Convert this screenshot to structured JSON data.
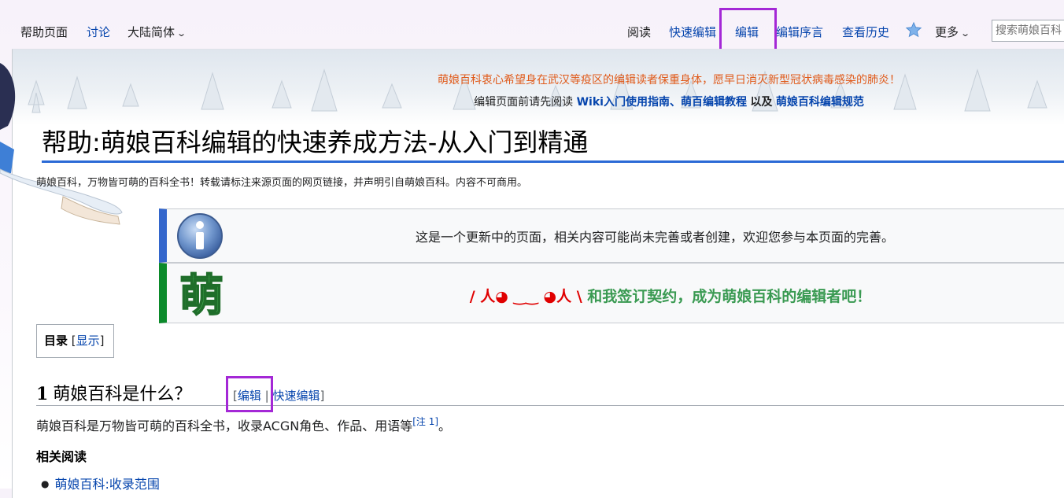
{
  "top_nav": {
    "left": {
      "help_page": "帮助页面",
      "discussion": "讨论",
      "variant": "大陆简体"
    },
    "right": {
      "read": "阅读",
      "quick_edit": "快速编辑",
      "edit": "编辑",
      "edit_intro": "编辑序言",
      "view_history": "查看历史",
      "more": "更多",
      "search_placeholder": "搜索萌娘百科"
    }
  },
  "site_notice": {
    "line1": "萌娘百科衷心希望身在武汉等疫区的编辑读者保重身体，愿早日消灭新型冠状病毒感染的肺炎！",
    "line2_prefix": "编辑页面前请先阅读",
    "link1": "Wiki入门使用指南",
    "sep": "、",
    "link2": "萌百编辑教程",
    "and": "以及",
    "link3": "萌娘百科编辑规范"
  },
  "page": {
    "title": "帮助:萌娘百科编辑的快速养成方法-从入门到精通",
    "tagline": "萌娘百科，万物皆可萌的百科全书！转载请标注来源页面的网页链接，并声明引自萌娘百科。内容不可商用。"
  },
  "notices": {
    "updating": "这是一个更新中的页面，相关内容可能尚未完善或者创建，欢迎您参与本页面的完善。",
    "moe_icon_char": "萌",
    "contract_kaomoji": "/ 人◕ ‿‿ ◕人 \\",
    "contract_text": "和我签订契约，成为萌娘百科的编辑者吧！"
  },
  "toc": {
    "label": "目录",
    "bracket_open": "[",
    "toggle": "显示",
    "bracket_close": "]"
  },
  "section1": {
    "number": "1",
    "heading": "萌娘百科是什么？",
    "bracket_open": "[",
    "edit": "编辑",
    "sep": " | ",
    "quick_edit": "快速编辑",
    "bracket_close": "]"
  },
  "body": {
    "para1_text": "萌娘百科是万物皆可萌的百科全书，收录ACGN角色、作品、用语等",
    "para1_note": "[注 1]",
    "para1_end": "。",
    "related_heading": "相关阅读",
    "related_items": [
      "萌娘百科:收录范围"
    ]
  },
  "colors": {
    "link": "#0645ad",
    "highlight_box": "#a428d6",
    "info_bar": "#3366cc",
    "moe_bar": "#0b8a2a",
    "notice_orange": "#e05a1a",
    "contract_green": "#3a9a52",
    "kaomoji_red": "#e00000"
  }
}
